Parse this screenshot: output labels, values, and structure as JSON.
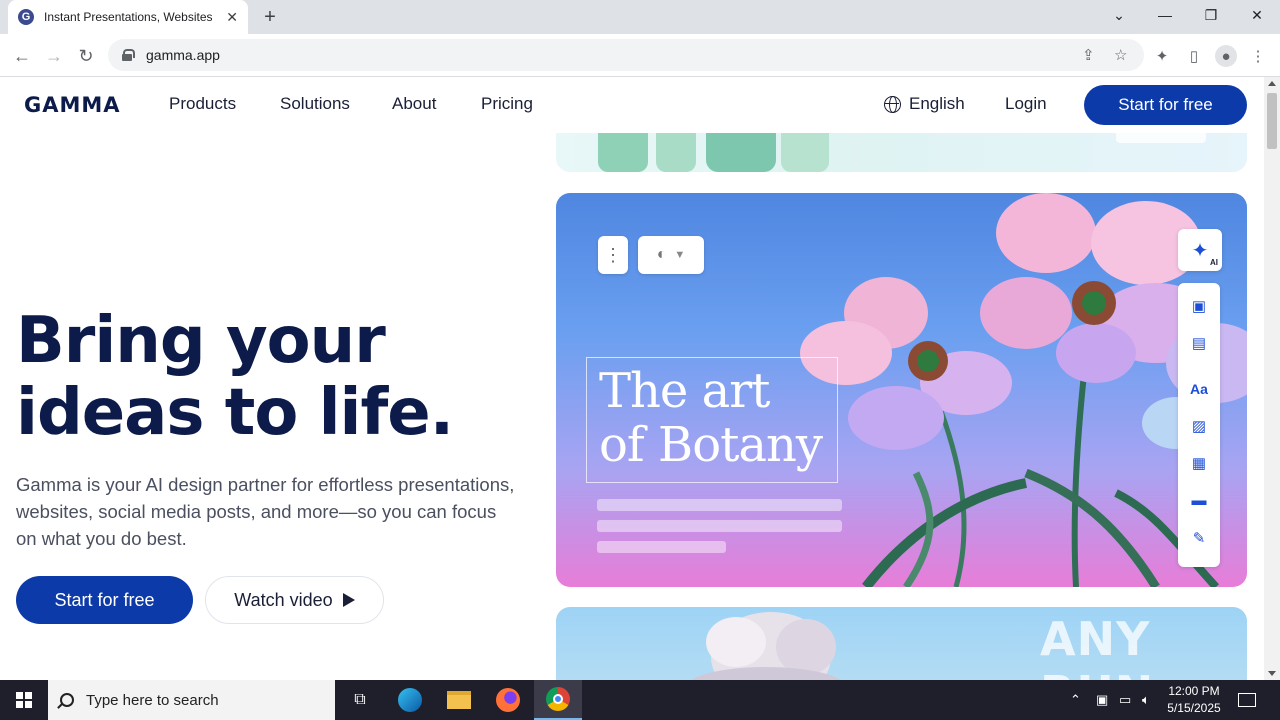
{
  "browser": {
    "tab_title": "Instant Presentations, Websites,",
    "tab_favicon": "G",
    "url": "gamma.app"
  },
  "nav": {
    "logo": "GAMMA",
    "links": [
      "Products",
      "Solutions",
      "About",
      "Pricing"
    ],
    "language": "English",
    "login": "Login",
    "cta": "Start for free"
  },
  "hero": {
    "title_line1": "Bring your",
    "title_line2": "ideas to life.",
    "subtitle": "Gamma is your AI design partner for effortless presentations, websites, social media posts, and more—so you can focus on what you do best.",
    "cta_primary": "Start for free",
    "cta_secondary": "Watch video"
  },
  "showcase": {
    "art_title_line1": "The art",
    "art_title_line2": "of Botany",
    "ai_badge": "AI",
    "side_icon_text": "Aa"
  },
  "watermark": "ANY RUN",
  "taskbar": {
    "search_placeholder": "Type here to search",
    "time": "12:00 PM",
    "date": "5/15/2025"
  },
  "colors": {
    "brand_navy": "#0d1b4a",
    "cta_blue": "#0d3aa9",
    "card_gradient_top": "#4f86e0",
    "card_gradient_bottom": "#e77dd8"
  }
}
